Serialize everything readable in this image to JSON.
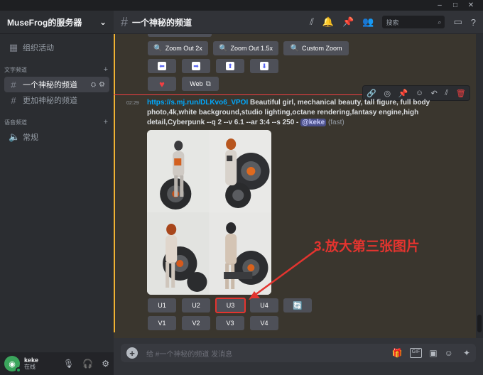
{
  "window": {
    "minimize": "–",
    "maximize": "□",
    "close": "✕"
  },
  "server": {
    "name": "MuseFrog的服务器",
    "chevron": "⌄"
  },
  "sidebar": {
    "events_label": "组织活动",
    "text_category": "文字频道",
    "channels": [
      {
        "label": "一个神秘的频道",
        "active": true
      },
      {
        "label": "更加神秘的频道",
        "active": false
      }
    ],
    "voice_category": "语音频道",
    "voice_channels": [
      {
        "label": "常规"
      }
    ]
  },
  "user": {
    "name": "keke",
    "status": "在线",
    "avatar_letter": "◉"
  },
  "header": {
    "channel": "一个神秘的频道",
    "search_placeholder": "搜索"
  },
  "buttons_row1": [
    "Zoom Out 2x",
    "Zoom Out 1.5x",
    "Custom Zoom"
  ],
  "buttons_row2": [
    "⬅",
    "➡",
    "⬆",
    "⬇"
  ],
  "buttons_row3": {
    "heart": "♥",
    "web": "Web"
  },
  "message": {
    "time": "02:29",
    "link": "https://s.mj.run/DLKvo6_VPOI",
    "prompt": " Beautiful girl, mechanical beauty, tall figure, full body photo,4k,white background,studio lighting,octane rendering,fantasy engine,high detail,Cyberpunk --q 2 --v 6.1 --ar 3:4 --s 250 - ",
    "mention": "@keke",
    "suffix": " (fast)"
  },
  "upscale_buttons": [
    "U1",
    "U2",
    "U3",
    "U4"
  ],
  "variation_buttons": [
    "V1",
    "V2",
    "V3",
    "V4"
  ],
  "reroll": "🔄",
  "annotation": "3.放大第三张图片",
  "input": {
    "placeholder": "给 #一个神秘的频道 发消息",
    "gif": "GIF"
  },
  "accent": {
    "highlight": "#f0b232",
    "annotation_red": "#e3342f",
    "link": "#00a8fc"
  }
}
